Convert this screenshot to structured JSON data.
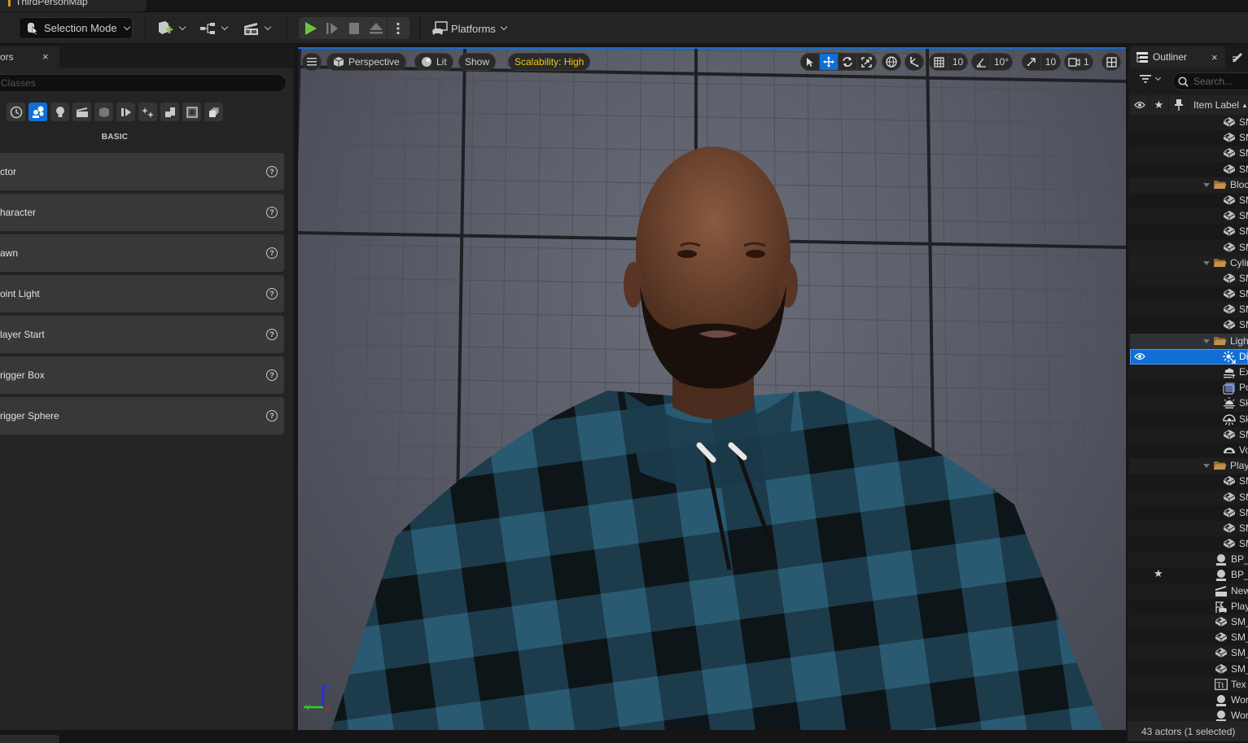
{
  "window": {
    "level_name": "ThirdPersonMap"
  },
  "toolbar": {
    "selection_mode_label": "Selection Mode",
    "add_content_icon": "add-actor-icon",
    "blueprint_icon": "blueprint-icon",
    "cinematics_icon": "clapperboard-icon",
    "play_icon": "play-icon",
    "advance_frame_icon": "advance-frame-icon",
    "stop_icon": "stop-icon",
    "eject_icon": "eject-icon",
    "more_icon": "kebab-icon",
    "platforms_label": "Platforms"
  },
  "place_actors": {
    "tab_label": "ors",
    "close_glyph": "×",
    "search_placeholder": "Classes",
    "categories": [
      {
        "name": "recently-placed",
        "active": false
      },
      {
        "name": "basic",
        "active": true
      },
      {
        "name": "lights",
        "active": false
      },
      {
        "name": "cinematic",
        "active": false
      },
      {
        "name": "visual-effects",
        "active": false
      },
      {
        "name": "geometry",
        "active": false
      },
      {
        "name": "effects",
        "active": false
      },
      {
        "name": "shapes",
        "active": false
      },
      {
        "name": "volumes",
        "active": false
      },
      {
        "name": "all-classes",
        "active": false
      }
    ],
    "section_label": "BASIC",
    "items": [
      {
        "label": "ctor"
      },
      {
        "label": "haracter"
      },
      {
        "label": "awn"
      },
      {
        "label": "oint Light"
      },
      {
        "label": "layer Start"
      },
      {
        "label": "rigger Box"
      },
      {
        "label": "rigger Sphere"
      }
    ],
    "help_glyph": "?"
  },
  "viewport": {
    "menu_icon": "hamburger-icon",
    "perspective_label": "Perspective",
    "lit_label": "Lit",
    "show_label": "Show",
    "scalability_label": "Scalability: High",
    "grid_snap_value": "10",
    "rotation_snap_value": "10°",
    "scale_snap_value": "10",
    "camera_speed_value": "1",
    "transform_tools": [
      "select",
      "translate",
      "rotate",
      "scale"
    ],
    "active_tool": "translate",
    "axis_labels": {
      "z": "Z",
      "y": "Y",
      "x": "X"
    },
    "colors": {
      "accent": "#0f6fd6",
      "scalability": "#f0c61a"
    }
  },
  "outliner": {
    "tab_label": "Outliner",
    "close_glyph": "×",
    "search_placeholder": "Search...",
    "column_label": "Item Label",
    "rows": [
      {
        "type": "mesh",
        "label": "SM",
        "depth": 2,
        "partial": true
      },
      {
        "type": "mesh",
        "label": "SM",
        "depth": 2
      },
      {
        "type": "mesh",
        "label": "SM",
        "depth": 2
      },
      {
        "type": "mesh",
        "label": "SM",
        "depth": 2
      },
      {
        "type": "folder",
        "label": "Blockout",
        "depth": 1
      },
      {
        "type": "mesh",
        "label": "SM",
        "depth": 2
      },
      {
        "type": "mesh",
        "label": "SM",
        "depth": 2
      },
      {
        "type": "mesh",
        "label": "SM",
        "depth": 2
      },
      {
        "type": "mesh",
        "label": "SM",
        "depth": 2
      },
      {
        "type": "folder",
        "label": "Cylinders",
        "depth": 1
      },
      {
        "type": "mesh",
        "label": "SM",
        "depth": 2
      },
      {
        "type": "mesh",
        "label": "SM",
        "depth": 2
      },
      {
        "type": "mesh",
        "label": "SM",
        "depth": 2
      },
      {
        "type": "mesh",
        "label": "SM",
        "depth": 2
      },
      {
        "type": "folder",
        "label": "Lighting",
        "depth": 1,
        "highlight": true
      },
      {
        "type": "dirlight",
        "label": "DirectionalLight",
        "depth": 2,
        "selected": true
      },
      {
        "type": "fog",
        "label": "ExponentialHeightFog",
        "depth": 2
      },
      {
        "type": "volume",
        "label": "PostProcessVolume",
        "depth": 2
      },
      {
        "type": "skyatmo",
        "label": "SkyAtmosphere",
        "depth": 2
      },
      {
        "type": "skylight",
        "label": "SkyLight",
        "depth": 2
      },
      {
        "type": "mesh",
        "label": "SM",
        "depth": 2
      },
      {
        "type": "cloud",
        "label": "VolumetricCloud",
        "depth": 2
      },
      {
        "type": "folder",
        "label": "PlayerStart",
        "depth": 1
      },
      {
        "type": "mesh",
        "label": "SM",
        "depth": 2
      },
      {
        "type": "mesh",
        "label": "SM",
        "depth": 2
      },
      {
        "type": "mesh",
        "label": "SM",
        "depth": 2
      },
      {
        "type": "mesh",
        "label": "SM",
        "depth": 2
      },
      {
        "type": "mesh",
        "label": "SM",
        "depth": 2
      },
      {
        "type": "actor",
        "label": "BP_",
        "depth": 0
      },
      {
        "type": "actor",
        "label": "BP_",
        "depth": 0,
        "starred": true
      },
      {
        "type": "sequence",
        "label": "New",
        "depth": 0
      },
      {
        "type": "playerstart",
        "label": "Play",
        "depth": 0
      },
      {
        "type": "mesh",
        "label": "SM_",
        "depth": 0
      },
      {
        "type": "mesh",
        "label": "SM_",
        "depth": 0
      },
      {
        "type": "mesh",
        "label": "SM_",
        "depth": 0
      },
      {
        "type": "mesh",
        "label": "SM_",
        "depth": 0
      },
      {
        "type": "text",
        "label": "Tex",
        "depth": 0
      },
      {
        "type": "actor",
        "label": "Wor",
        "depth": 0
      },
      {
        "type": "actor",
        "label": "Wor",
        "depth": 0
      }
    ],
    "status": "43 actors (1 selected)"
  }
}
